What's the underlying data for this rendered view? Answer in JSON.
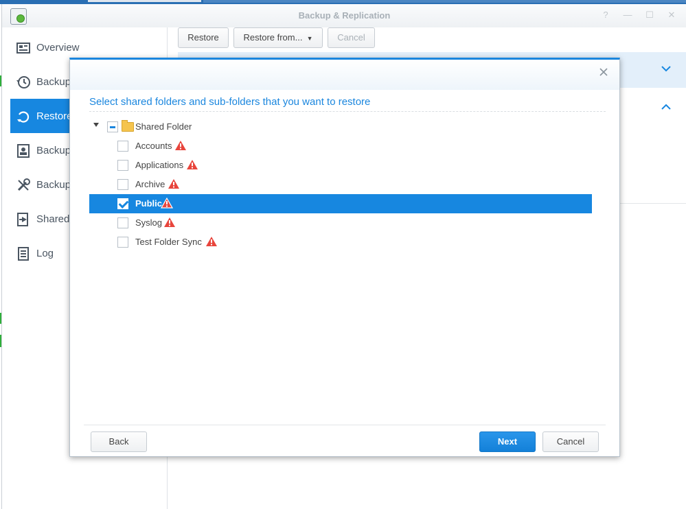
{
  "window": {
    "title": "Backup & Replication",
    "controls": [
      "?",
      "—",
      "☐",
      "✕"
    ]
  },
  "sidebar": {
    "items": [
      {
        "label": "Overview",
        "icon": "overview-icon",
        "active": false
      },
      {
        "label": "Backup",
        "icon": "backup-history-icon",
        "active": false
      },
      {
        "label": "Restore",
        "icon": "restore-icon",
        "active": true
      },
      {
        "label": "Backup",
        "icon": "backup-service-icon",
        "active": false
      },
      {
        "label": "Backup",
        "icon": "wrench-icon",
        "active": false
      },
      {
        "label": "Shared",
        "icon": "shared-export-icon",
        "active": false
      },
      {
        "label": "Log",
        "icon": "log-icon",
        "active": false
      }
    ]
  },
  "toolbar": {
    "restore_label": "Restore",
    "restore_from_label": "Restore from...",
    "cancel_label": "Cancel"
  },
  "dialog": {
    "heading": "Select shared folders and sub-folders that you want to restore",
    "tree": {
      "root": {
        "label": "Shared Folder",
        "state": "partial"
      },
      "children": [
        {
          "label": "Accounts",
          "checked": false,
          "warning": true
        },
        {
          "label": "Applications",
          "checked": false,
          "warning": true
        },
        {
          "label": "Archive",
          "checked": false,
          "warning": true
        },
        {
          "label": "Public",
          "checked": true,
          "warning": true,
          "selected": true
        },
        {
          "label": "Syslog",
          "checked": false,
          "warning": true
        },
        {
          "label": "Test Folder Sync",
          "checked": false,
          "warning": true
        }
      ]
    },
    "buttons": {
      "back_label": "Back",
      "next_label": "Next",
      "cancel_label": "Cancel"
    }
  },
  "colors": {
    "accent": "#1787e0",
    "warning": "#e8453c",
    "folder": "#f5c44e"
  }
}
